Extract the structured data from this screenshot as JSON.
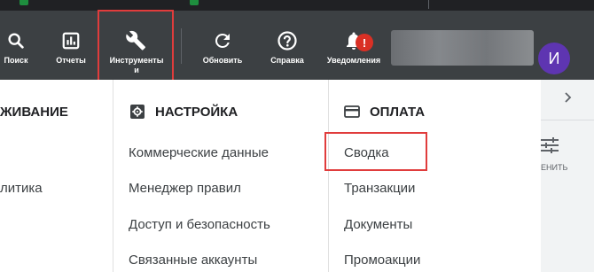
{
  "toolbar": {
    "search_label": "Поиск",
    "reports_label": "Отчеты",
    "tools_label": "Инструменты",
    "tools_label_line2": "и",
    "refresh_label": "Обновить",
    "help_label": "Справка",
    "notifications_label": "Уведомления",
    "notifications_badge": "!",
    "avatar_letter": "И"
  },
  "menu": {
    "col1": {
      "header": "ЖИВАНИЕ",
      "items": [
        "литика"
      ]
    },
    "col2": {
      "header": "НАСТРОЙКА",
      "icon": "gear-icon",
      "items": [
        "Коммерческие данные",
        "Менеджер правил",
        "Доступ и безопасность",
        "Связанные аккаунты"
      ]
    },
    "col3": {
      "header": "ОПЛАТА",
      "icon": "credit-card-icon",
      "items": [
        "Сводка",
        "Транзакции",
        "Документы",
        "Промоакции"
      ]
    }
  },
  "right_panel": {
    "filter_label": "ЕНИТЬ"
  },
  "colors": {
    "toolbar_bg": "#3c4043",
    "avatar_bg": "#5e35b1",
    "badge_bg": "#d93025",
    "highlight": "#e03c3c"
  }
}
